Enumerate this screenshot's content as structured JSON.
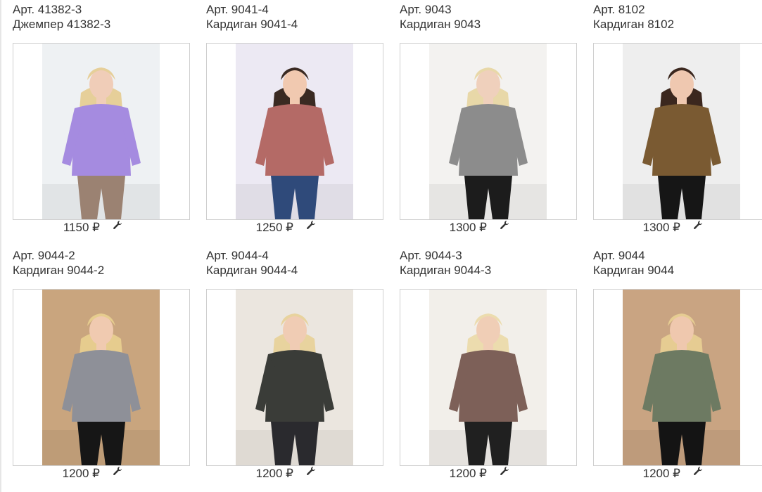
{
  "products": [
    {
      "sku": "Арт. 41382-3",
      "name": "Джемпер 41382-3",
      "price": "1150 ₽",
      "bg": "#eef1f3",
      "garment": "#a58be0",
      "pants": "#9b8272",
      "hair": "#e6cf99",
      "skin": "#f0cdb8"
    },
    {
      "sku": "Арт. 9041-4",
      "name": "Кардиган 9041-4",
      "price": "1250 ₽",
      "bg": "#ece9f3",
      "garment": "#b46a66",
      "pants": "#2f4a7a",
      "hair": "#3a2a22",
      "skin": "#f1c9b0"
    },
    {
      "sku": "Арт. 9043",
      "name": "Кардиган 9043",
      "price": "1300 ₽",
      "bg": "#f3f2f0",
      "garment": "#8c8c8c",
      "pants": "#1c1c1c",
      "hair": "#e8d8a8",
      "skin": "#efd0bc"
    },
    {
      "sku": "Арт. 8102",
      "name": "Кардиган 8102",
      "price": "1300 ₽",
      "bg": "#eeeeee",
      "garment": "#7a5a32",
      "pants": "#161616",
      "hair": "#3b271e",
      "skin": "#efc8b0"
    },
    {
      "sku": "Арт. 9044-2",
      "name": "Кардиган 9044-2",
      "price": "1200 ₽",
      "bg": "#c9a57e",
      "garment": "#8e9098",
      "pants": "#161616",
      "hair": "#e6cc8e",
      "skin": "#f0cab0"
    },
    {
      "sku": "Арт. 9044-4",
      "name": "Кардиган 9044-4",
      "price": "1200 ₽",
      "bg": "#ebe6df",
      "garment": "#3a3c38",
      "pants": "#2a2a2e",
      "hair": "#e8d39e",
      "skin": "#f0ccb4"
    },
    {
      "sku": "Арт. 9044-3",
      "name": "Кардиган 9044-3",
      "price": "1200 ₽",
      "bg": "#f2efea",
      "garment": "#7d6058",
      "pants": "#202020",
      "hair": "#ecdcae",
      "skin": "#f0ceb6"
    },
    {
      "sku": "Арт. 9044",
      "name": "Кардиган 9044",
      "price": "1200 ₽",
      "bg": "#c9a482",
      "garment": "#6d7a62",
      "pants": "#141414",
      "hair": "#e6cc92",
      "skin": "#efc8ae"
    }
  ],
  "icons": {
    "edit": "wrench-icon"
  }
}
